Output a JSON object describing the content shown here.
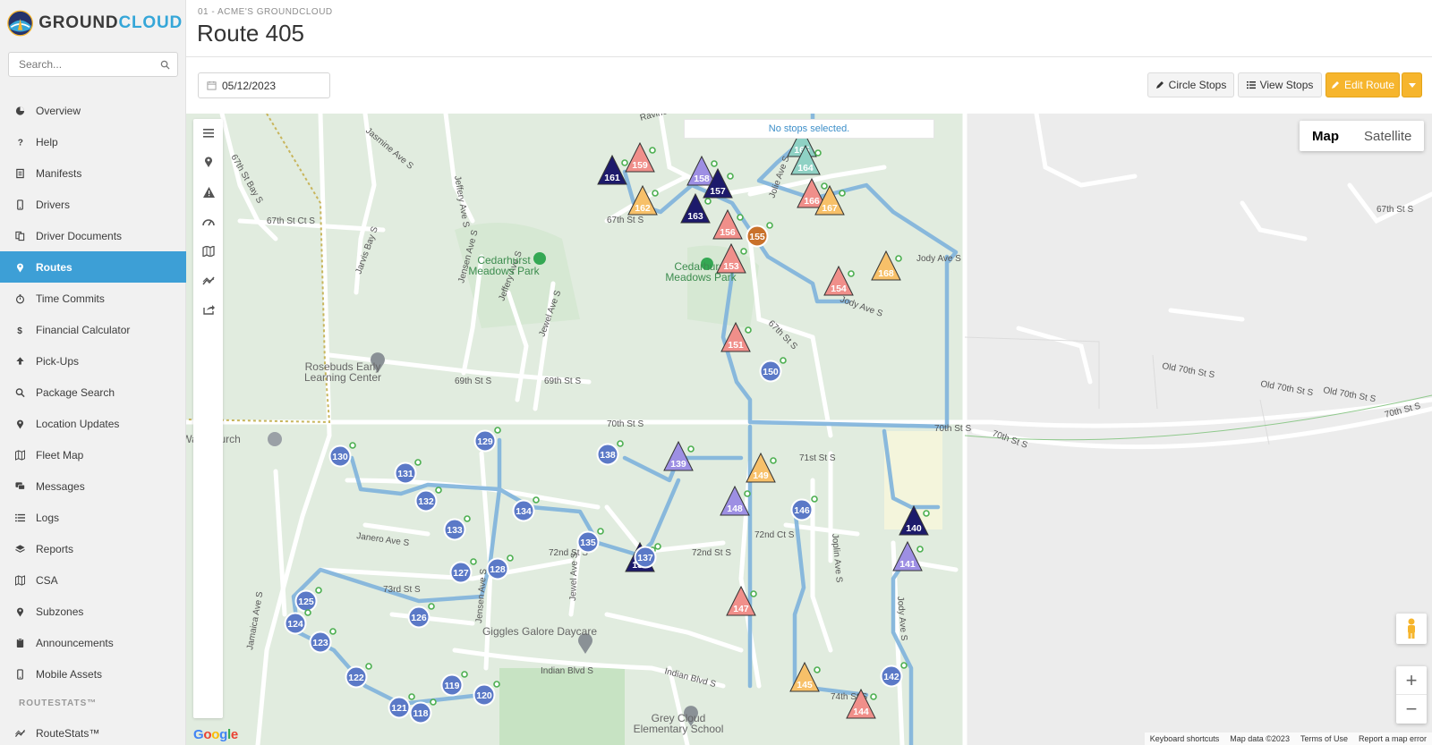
{
  "brand": {
    "part1": "GROUND",
    "part2": "CLOUD"
  },
  "search": {
    "placeholder": "Search..."
  },
  "nav": {
    "items": [
      {
        "label": "Overview",
        "icon": "pie-chart-icon"
      },
      {
        "label": "Help",
        "icon": "question-icon"
      },
      {
        "label": "Manifests",
        "icon": "list-doc-icon"
      },
      {
        "label": "Drivers",
        "icon": "phone-icon"
      },
      {
        "label": "Driver Documents",
        "icon": "documents-icon"
      },
      {
        "label": "Routes",
        "icon": "map-pin-icon",
        "active": true
      },
      {
        "label": "Time Commits",
        "icon": "stopwatch-icon"
      },
      {
        "label": "Financial Calculator",
        "icon": "dollar-icon"
      },
      {
        "label": "Pick-Ups",
        "icon": "upload-icon"
      },
      {
        "label": "Package Search",
        "icon": "search-icon"
      },
      {
        "label": "Location Updates",
        "icon": "map-pin-icon"
      },
      {
        "label": "Fleet Map",
        "icon": "map-icon"
      },
      {
        "label": "Messages",
        "icon": "chat-icon"
      },
      {
        "label": "Logs",
        "icon": "list-icon"
      },
      {
        "label": "Reports",
        "icon": "layers-icon"
      },
      {
        "label": "CSA",
        "icon": "map-icon"
      },
      {
        "label": "Subzones",
        "icon": "map-pin-icon"
      },
      {
        "label": "Announcements",
        "icon": "clipboard-icon"
      },
      {
        "label": "Mobile Assets",
        "icon": "phone-icon"
      }
    ],
    "section": "ROUTESTATS™",
    "extra": {
      "label": "RouteStats™",
      "icon": "chart-icon"
    }
  },
  "header": {
    "crumb": "01 - ACME'S GROUNDCLOUD",
    "title": "Route 405"
  },
  "toolbar": {
    "date": "05/12/2023",
    "circle_stops": "Circle Stops",
    "view_stops": "View Stops",
    "edit_route": "Edit Route"
  },
  "colors": {
    "accent": "#3d9fd6",
    "primary_button": "#f6b52d",
    "route_line": "#7fb3dc",
    "map_bg": "#e9eee9"
  },
  "map": {
    "banner": "No stops selected.",
    "type_map": "Map",
    "type_satellite": "Satellite",
    "zoom_in": "+",
    "zoom_out": "−",
    "google": "Google",
    "attribution": [
      "Keyboard shortcuts",
      "Map data ©2023",
      "Terms of Use",
      "Report a map error"
    ],
    "tools": [
      "menu-icon",
      "map-pin-icon",
      "warning-icon",
      "speedometer-icon",
      "map-icon",
      "chart-line-icon",
      "share-icon"
    ],
    "street_labels": [
      "Ravine Pkwy",
      "Jasmine Ave S",
      "67th St Bay S",
      "67th St Ct S",
      "Jeffery Ave S",
      "67th St S",
      "Jarvis Bay S",
      "Jensen Ave S",
      "Jeffery Ave S",
      "Jewel Ave S",
      "69th St S",
      "69th St S",
      "70th St S",
      "70th St S",
      "71st St S",
      "72nd St S",
      "72nd St S",
      "72nd Ct S",
      "73rd St S",
      "Janero Ave S",
      "Jamaica Ave S",
      "Jensen Ave S",
      "Jewel Ave S",
      "Indian Blvd S",
      "Indian Blvd S",
      "Joplin Ave S",
      "Jody Ave S",
      "67th St S",
      "Old 70th St S",
      "Old 70th St S",
      "Old 70th St S",
      "70th St S",
      "70th St S",
      "67th St S",
      "74th St S",
      "Jolie Ave S",
      "Jody Ave S",
      "Jody Ave S"
    ],
    "places": [
      {
        "label": [
          "Cedarhurst",
          "Meadows Park"
        ]
      },
      {
        "label": [
          "Cedarhurst",
          "Meadows Park"
        ]
      },
      {
        "label": [
          "Rosebuds Early",
          "Learning Center"
        ]
      },
      {
        "label": [
          "Way Church"
        ]
      },
      {
        "label": [
          "Giggles Galore Daycare"
        ]
      },
      {
        "label": [
          "Grey Cloud",
          "Elementary School"
        ]
      }
    ]
  },
  "stops": [
    {
      "n": "161",
      "s": "tri",
      "c": "#1d1a6b"
    },
    {
      "n": "159",
      "s": "tri",
      "c": "#f08f8a"
    },
    {
      "n": "158",
      "s": "tri",
      "c": "#9d8fe3"
    },
    {
      "n": "157",
      "s": "tri",
      "c": "#1d1a6b"
    },
    {
      "n": "162",
      "s": "tri",
      "c": "#f7c069"
    },
    {
      "n": "163",
      "s": "tri",
      "c": "#1d1a6b"
    },
    {
      "n": "156",
      "s": "tri",
      "c": "#f08f8a"
    },
    {
      "n": "155",
      "s": "circ",
      "c": "#c9712a"
    },
    {
      "n": "153",
      "s": "tri",
      "c": "#f08f8a"
    },
    {
      "n": "165",
      "s": "tri",
      "c": "#8fd1c4"
    },
    {
      "n": "164",
      "s": "tri",
      "c": "#8fd1c4"
    },
    {
      "n": "166",
      "s": "tri",
      "c": "#f08f8a"
    },
    {
      "n": "167",
      "s": "tri",
      "c": "#f7c069"
    },
    {
      "n": "168",
      "s": "tri",
      "c": "#f7c069"
    },
    {
      "n": "154",
      "s": "tri",
      "c": "#f08f8a"
    },
    {
      "n": "151",
      "s": "tri",
      "c": "#f08f8a"
    },
    {
      "n": "150",
      "s": "circ",
      "c": "#5b79c7"
    },
    {
      "n": "130",
      "s": "circ",
      "c": "#5b79c7"
    },
    {
      "n": "131",
      "s": "circ",
      "c": "#5b79c7"
    },
    {
      "n": "132",
      "s": "circ",
      "c": "#5b79c7"
    },
    {
      "n": "129",
      "s": "circ",
      "c": "#5b79c7"
    },
    {
      "n": "133",
      "s": "circ",
      "c": "#5b79c7"
    },
    {
      "n": "134",
      "s": "circ",
      "c": "#5b79c7"
    },
    {
      "n": "138",
      "s": "circ",
      "c": "#5b79c7"
    },
    {
      "n": "139",
      "s": "tri",
      "c": "#9d8fe3"
    },
    {
      "n": "149",
      "s": "tri",
      "c": "#f7c069"
    },
    {
      "n": "148",
      "s": "tri",
      "c": "#9d8fe3"
    },
    {
      "n": "146",
      "s": "circ",
      "c": "#5b79c7"
    },
    {
      "n": "135",
      "s": "circ",
      "c": "#5b79c7"
    },
    {
      "n": "136",
      "s": "tri",
      "c": "#1d1a6b"
    },
    {
      "n": "137",
      "s": "circ",
      "c": "#5b79c7"
    },
    {
      "n": "128",
      "s": "circ",
      "c": "#5b79c7"
    },
    {
      "n": "127",
      "s": "circ",
      "c": "#5b79c7"
    },
    {
      "n": "125",
      "s": "circ",
      "c": "#5b79c7"
    },
    {
      "n": "126",
      "s": "circ",
      "c": "#5b79c7"
    },
    {
      "n": "124",
      "s": "circ",
      "c": "#5b79c7"
    },
    {
      "n": "123",
      "s": "circ",
      "c": "#5b79c7"
    },
    {
      "n": "122",
      "s": "circ",
      "c": "#5b79c7"
    },
    {
      "n": "119",
      "s": "circ",
      "c": "#5b79c7"
    },
    {
      "n": "120",
      "s": "circ",
      "c": "#5b79c7"
    },
    {
      "n": "121",
      "s": "circ",
      "c": "#5b79c7"
    },
    {
      "n": "118",
      "s": "circ",
      "c": "#5b79c7"
    },
    {
      "n": "140",
      "s": "tri",
      "c": "#1d1a6b"
    },
    {
      "n": "141",
      "s": "tri",
      "c": "#9d8fe3"
    },
    {
      "n": "147",
      "s": "tri",
      "c": "#f08f8a"
    },
    {
      "n": "142",
      "s": "circ",
      "c": "#5b79c7"
    },
    {
      "n": "145",
      "s": "tri",
      "c": "#f7c069"
    },
    {
      "n": "144",
      "s": "tri",
      "c": "#f08f8a"
    }
  ]
}
